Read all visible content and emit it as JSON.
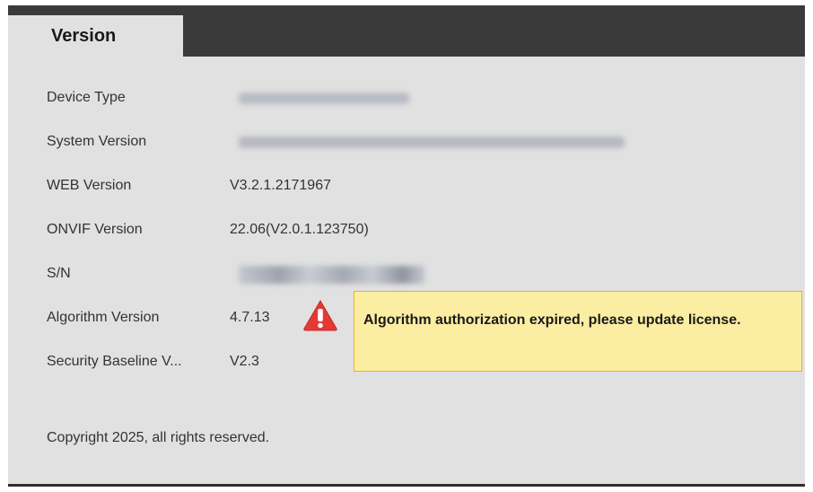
{
  "tab": {
    "label": "Version"
  },
  "rows": [
    {
      "label": "Device Type",
      "value": ""
    },
    {
      "label": "System Version",
      "value": ""
    },
    {
      "label": "WEB Version",
      "value": "V3.2.1.2171967"
    },
    {
      "label": "ONVIF Version",
      "value": "22.06(V2.0.1.123750)"
    },
    {
      "label": "S/N",
      "value": ""
    },
    {
      "label": "Algorithm Version",
      "value": "4.7.13"
    },
    {
      "label": "Security Baseline V...",
      "value": "V2.3"
    }
  ],
  "warning": {
    "icon": "warning-triangle-icon",
    "message": "Algorithm authorization expired, please update license."
  },
  "footer": {
    "copyright": "Copyright 2025, all rights reserved."
  },
  "colors": {
    "tab_bar": "#3a3a3a",
    "panel_bg": "#e1e1e1",
    "warning_icon": "#e53935",
    "tooltip_bg": "#fbeea3",
    "tooltip_border": "#e6b12a"
  }
}
